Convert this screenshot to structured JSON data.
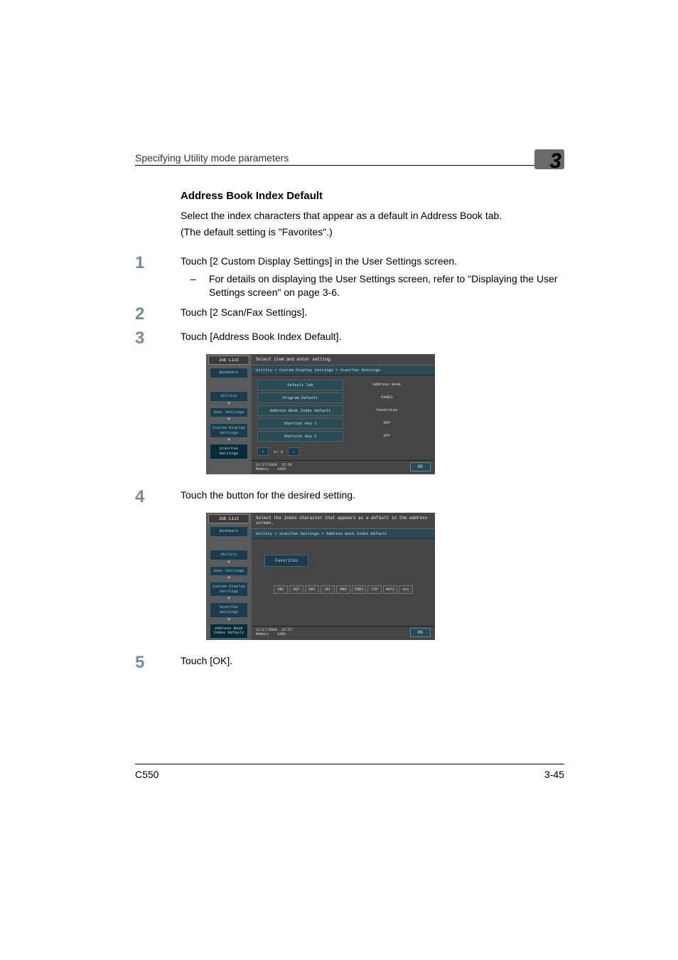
{
  "header": {
    "running": "Specifying Utility mode parameters",
    "chapter": "3"
  },
  "section_title": "Address Book Index Default",
  "intro1": "Select the index characters that appear as a default in Address Book tab.",
  "intro2": "(The default setting is \"Favorites\".)",
  "steps": [
    {
      "num": "1",
      "text": "Touch [2 Custom Display Settings] in the User Settings screen.",
      "sub": "For details on displaying the User Settings screen, refer to \"Displaying the User Settings screen\" on page 3-6."
    },
    {
      "num": "2",
      "text": "Touch [2 Scan/Fax Settings]."
    },
    {
      "num": "3",
      "text": "Touch [Address Book Index Default]."
    },
    {
      "num": "4",
      "text": "Touch the button for the desired setting."
    },
    {
      "num": "5",
      "text": "Touch [OK]."
    }
  ],
  "screen1": {
    "job_list": "Job List",
    "bookmark": "Bookmark",
    "crumbs": [
      "Utility",
      "User Settings",
      "Custom Display Settings",
      "Scan/Fax Settings"
    ],
    "top_msg": "Select item and enter setting.",
    "breadcrumb": "Utility > Custom Display Settings > Scan/Fax Settings",
    "rows": [
      {
        "label": "Default Tab",
        "value": "Address Book"
      },
      {
        "label": "Program Default",
        "value": "PAGE1"
      },
      {
        "label": "Address Book Index Default",
        "value": "Favorites"
      },
      {
        "label": "Shortcut Key 1",
        "value": "OFF"
      },
      {
        "label": "Shortcut Key 2",
        "value": "OFF"
      }
    ],
    "pager": "1/ 2",
    "date": "11/17/2006",
    "time": "15:56",
    "mem_label": "Memory",
    "mem_val": "100%",
    "ok": "OK"
  },
  "screen2": {
    "job_list": "Job List",
    "bookmark": "Bookmark",
    "crumbs": [
      "Utility",
      "User Settings",
      "Custom Display Settings",
      "Scan/Fax Settings",
      "Address Book Index Default"
    ],
    "top_msg": "Select the index character that appears as a default in the address screen.",
    "breadcrumb": "Utility > Scan/Fax Settings > Address Book Index Default",
    "favorites": "Favorites",
    "idx": [
      "ABC",
      "DEF",
      "GHI",
      "JKL",
      "MNO",
      "PQRS",
      "TUV",
      "WXYZ",
      "etc"
    ],
    "date": "11/17/2006",
    "time": "15:57",
    "mem_label": "Memory",
    "mem_val": "100%",
    "ok": "OK"
  },
  "footer": {
    "model": "C550",
    "page": "3-45"
  }
}
